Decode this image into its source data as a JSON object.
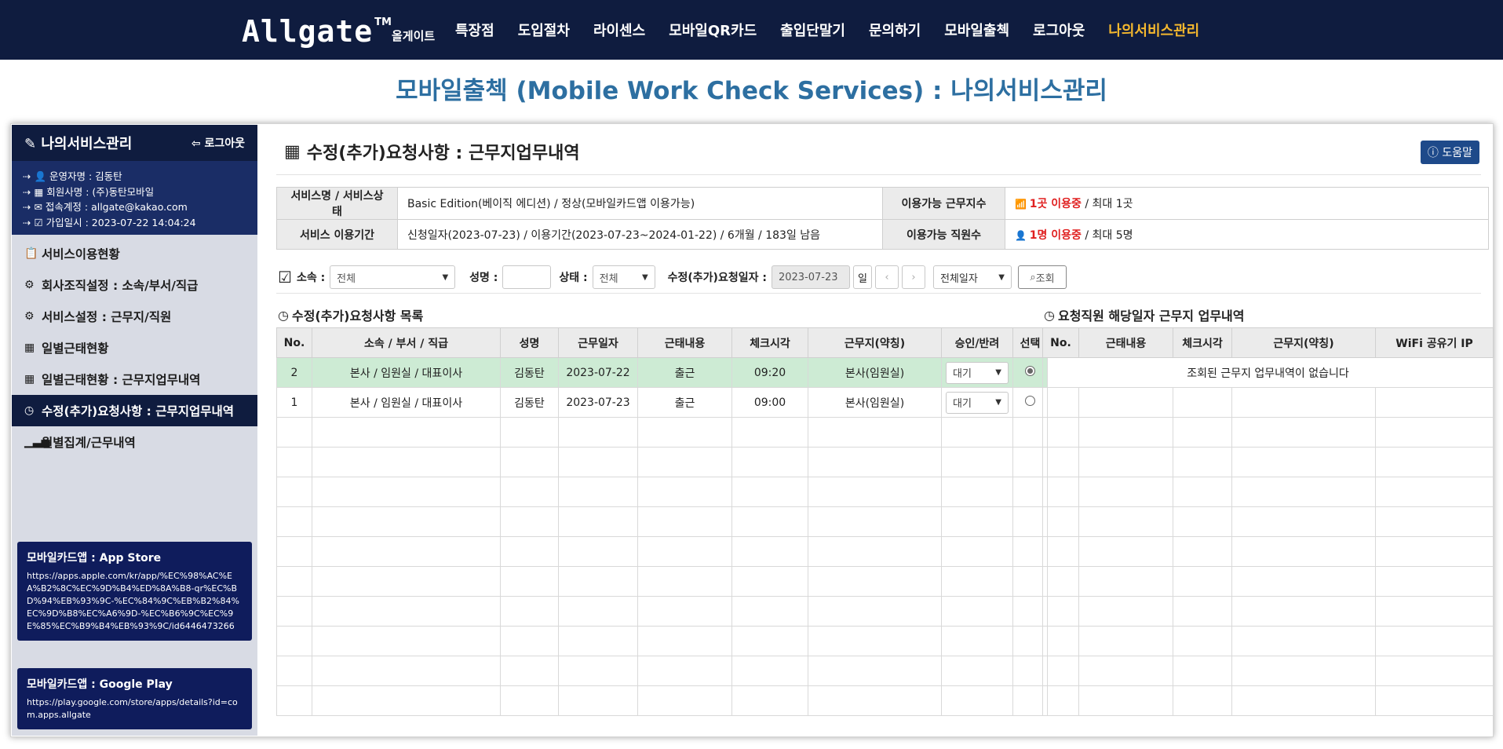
{
  "brand": {
    "logo_text": "Allgate",
    "tm": "TM",
    "korean": "올게이트"
  },
  "nav": [
    "특장점",
    "도입절차",
    "라이센스",
    "모바일QR카드",
    "출입단말기",
    "문의하기",
    "모바일출첵",
    "로그아웃",
    "나의서비스관리"
  ],
  "page_title": "모바일출첵 (Mobile Work Check Services) : 나의서비스관리",
  "sidebar": {
    "title": "나의서비스관리",
    "logout": "로그아웃",
    "info": [
      "운영자명 : 김동탄",
      "회원사명 : (주)동탄모바일",
      "접속계정 : allgate@kakao.com",
      "가입일시 : 2023-07-22 14:04:24"
    ],
    "menu": [
      "서비스이용현황",
      "회사조직설정 : 소속/부서/직급",
      "서비스설정 : 근무지/직원",
      "일별근태현황",
      "일별근태현황 : 근무지업무내역",
      "수정(추가)요청사항 : 근무지업무내역",
      "월별집계/근무내역"
    ],
    "appstore": {
      "title": "모바일카드앱 : App Store",
      "url": "https://apps.apple.com/kr/app/%EC%98%AC%EA%B2%8C%EC%9D%B4%ED%8A%B8-qr%EC%BD%94%EB%93%9C-%EC%84%9C%EB%B2%84%EC%9D%B8%EC%A6%9D-%EC%B6%9C%EC%9E%85%EC%B9%B4%EB%93%9C/id6446473266"
    },
    "googleplay": {
      "title": "모바일카드앱 : Google Play",
      "url": "https://play.google.com/store/apps/details?id=com.apps.allgate"
    }
  },
  "main": {
    "title": "수정(추가)요청사항 : 근무지업무내역",
    "help": "도움말",
    "service": {
      "name_label": "서비스명 / 서비스상태",
      "name_value": "Basic Edition(베이직 에디션) / 정상(모바일카드앱 이용가능)",
      "sites_label": "이용가능 근무지수",
      "sites_used": "1곳 이용중",
      "sites_max": " / 최대 1곳",
      "period_label": "서비스 이용기간",
      "period_value": "신청일자(2023-07-23) / 이용기간(2023-07-23~2024-01-22) / 6개월 / 183일 남음",
      "staff_label": "이용가능 직원수",
      "staff_used": "1명 이용중",
      "staff_max": " / 최대 5명"
    },
    "filter": {
      "affil_label": "소속 :",
      "affil_value": "전체",
      "name_label": "성명 :",
      "name_value": "",
      "status_label": "상태 :",
      "status_value": "전체",
      "date_label": "수정(추가)요청일자 :",
      "date_value": "2023-07-23",
      "day_btn": "일",
      "range_value": "전체일자",
      "search_btn": "조회"
    },
    "list": {
      "title": "수정(추가)요청사항 목록",
      "headers": [
        "No.",
        "소속 / 부서 / 직급",
        "성명",
        "근무일자",
        "근태내용",
        "체크시각",
        "근무지(약칭)",
        "승인/반려",
        "선택"
      ],
      "rows": [
        {
          "no": "2",
          "org": "본사 / 임원실 / 대표이사",
          "name": "김동탄",
          "date": "2023-07-22",
          "type": "출근",
          "time": "09:20",
          "site": "본사(임원실)",
          "approval": "대기",
          "selected": true
        },
        {
          "no": "1",
          "org": "본사 / 임원실 / 대표이사",
          "name": "김동탄",
          "date": "2023-07-23",
          "type": "출근",
          "time": "09:00",
          "site": "본사(임원실)",
          "approval": "대기",
          "selected": false
        }
      ]
    },
    "detail": {
      "title": "요청직원 해당일자 근무지 업무내역",
      "headers": [
        "No.",
        "근태내용",
        "체크시각",
        "근무지(약칭)",
        "WiFi 공유기 IP"
      ],
      "empty": "조회된 근무지 업무내역이 없습니다"
    }
  }
}
